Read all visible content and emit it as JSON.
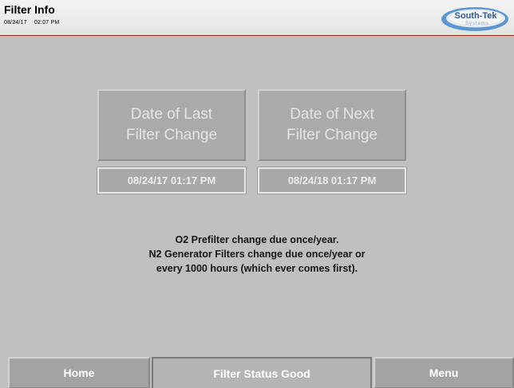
{
  "header": {
    "title": "Filter Info",
    "date": "08/24/17",
    "time": "02:07 PM",
    "logo_text": "South-Tek",
    "logo_subtext": "Systems"
  },
  "main": {
    "last_change_label_line1": "Date of Last",
    "last_change_label_line2": "Filter Change",
    "next_change_label_line1": "Date of Next",
    "next_change_label_line2": "Filter Change",
    "last_change_value": "08/24/17 01:17 PM",
    "next_change_value": "08/24/18 01:17 PM",
    "info_line1": "O2 Prefilter change due once/year.",
    "info_line2": "N2 Generator Filters change due once/year or",
    "info_line3": "every 1000 hours (which ever comes first)."
  },
  "footer": {
    "home_label": "Home",
    "status_label": "Filter Status Good",
    "menu_label": "Menu"
  },
  "colors": {
    "background": "#c0c0c0",
    "header_border": "#9a1f1f",
    "logo_blue": "#4a86c8"
  }
}
